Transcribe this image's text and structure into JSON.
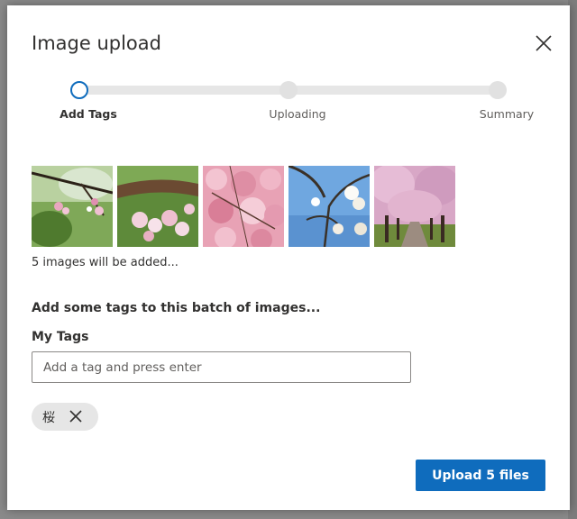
{
  "dialog": {
    "title": "Image upload",
    "close_icon": "close-icon"
  },
  "stepper": {
    "steps": [
      {
        "label": "Add Tags",
        "state": "active"
      },
      {
        "label": "Uploading",
        "state": "pending"
      },
      {
        "label": "Summary",
        "state": "pending"
      }
    ],
    "accent_color": "#0f6cbd"
  },
  "images": {
    "thumbnails": [
      {
        "alt": "cherry blossom branch"
      },
      {
        "alt": "cherry blossoms on bark"
      },
      {
        "alt": "pink cherry blossoms"
      },
      {
        "alt": "white blossoms against sky"
      },
      {
        "alt": "cherry tree avenue"
      }
    ],
    "count_text": "5 images will be added..."
  },
  "tags": {
    "heading": "Add some tags to this batch of images...",
    "field_label": "My Tags",
    "input_value": "",
    "input_placeholder": "Add a tag and press enter",
    "chips": [
      {
        "label": "桜",
        "remove_icon": "close-icon"
      }
    ]
  },
  "footer": {
    "upload_label": "Upload 5 files",
    "primary_color": "#0f6cbd"
  }
}
